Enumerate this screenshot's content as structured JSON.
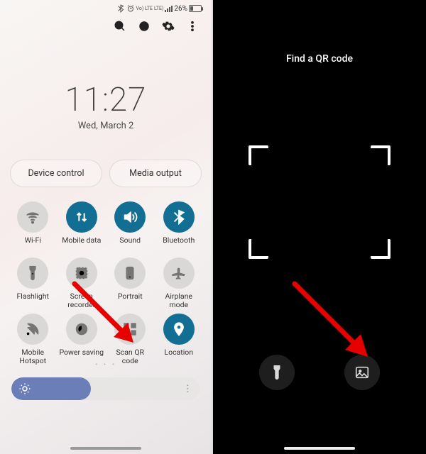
{
  "status": {
    "lte_badges": [
      "Vo) LTE",
      "LTE)"
    ],
    "battery_pct": "26%"
  },
  "clock": {
    "time": "11:27",
    "date": "Wed, March 2"
  },
  "pills": {
    "device_control": "Device control",
    "media_output": "Media output"
  },
  "tiles": [
    {
      "id": "wifi",
      "label": "Wi-Fi",
      "on": false,
      "icon": "wifi"
    },
    {
      "id": "mobile-data",
      "label": "Mobile data",
      "on": true,
      "icon": "updown"
    },
    {
      "id": "sound",
      "label": "Sound",
      "on": true,
      "icon": "sound"
    },
    {
      "id": "bluetooth",
      "label": "Bluetooth",
      "on": true,
      "icon": "bluetooth"
    },
    {
      "id": "flashlight",
      "label": "Flashlight",
      "on": false,
      "icon": "flashlight"
    },
    {
      "id": "screen-recorder",
      "label": "Screen recorder",
      "on": false,
      "icon": "record"
    },
    {
      "id": "portrait",
      "label": "Portrait",
      "on": false,
      "icon": "portrait"
    },
    {
      "id": "airplane",
      "label": "Airplane mode",
      "on": false,
      "icon": "airplane"
    },
    {
      "id": "mobile-hotspot",
      "label": "Mobile Hotspot",
      "on": false,
      "icon": "hotspot"
    },
    {
      "id": "power-saving",
      "label": "Power saving",
      "on": false,
      "icon": "powersave"
    },
    {
      "id": "scan-qr",
      "label": "Scan QR code",
      "on": false,
      "icon": "qr"
    },
    {
      "id": "location",
      "label": "Location",
      "on": true,
      "icon": "location"
    }
  ],
  "slider": {
    "level_pct": 42
  },
  "scanner": {
    "prompt": "Find a QR code"
  }
}
